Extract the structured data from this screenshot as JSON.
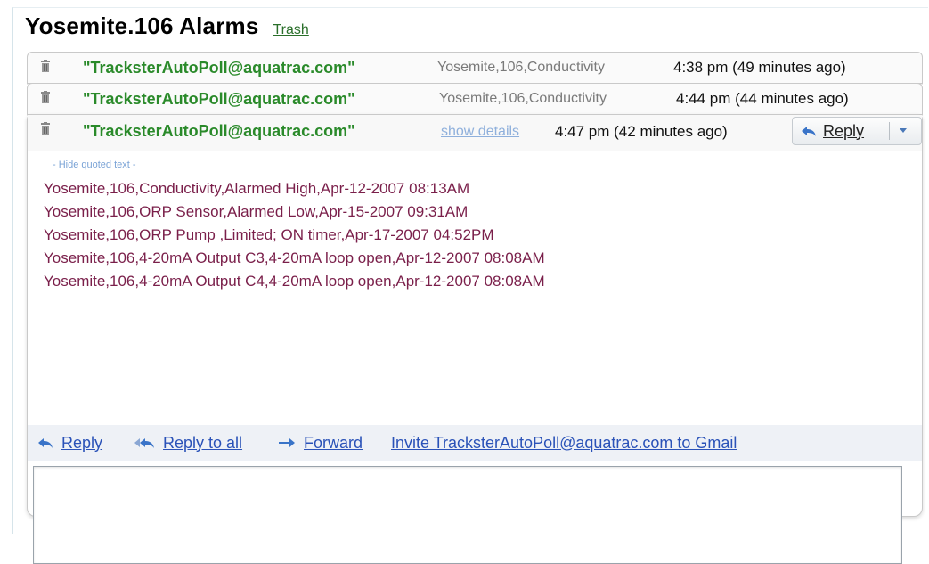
{
  "page": {
    "title": "Yosemite.106 Alarms",
    "trash_link": "Trash"
  },
  "thread": {
    "messages": [
      {
        "sender": "\"TracksterAutoPoll@aquatrac.com\"",
        "subject": "Yosemite,106,Conductivity",
        "time": "4:38 pm (49 minutes ago)"
      },
      {
        "sender": "\"TracksterAutoPoll@aquatrac.com\"",
        "subject": "Yosemite,106,Conductivity",
        "time": "4:44 pm (44 minutes ago)"
      }
    ],
    "expanded": {
      "sender": "\"TracksterAutoPoll@aquatrac.com\"",
      "show_details": "show details",
      "time": "4:47 pm (42 minutes ago)",
      "reply_label": "Reply",
      "hide_quoted": "- Hide quoted text -",
      "body_lines": [
        "Yosemite,106,Conductivity,Alarmed High,Apr-12-2007 08:13AM",
        "Yosemite,106,ORP Sensor,Alarmed Low,Apr-15-2007 09:31AM",
        "Yosemite,106,ORP Pump ,Limited; ON timer,Apr-17-2007 04:52PM",
        "Yosemite,106,4-20mA Output C3,4-20mA loop open,Apr-12-2007 08:08AM",
        "Yosemite,106,4-20mA Output C4,4-20mA loop open,Apr-12-2007 08:08AM"
      ],
      "actions": {
        "reply": "Reply",
        "reply_all": "Reply to all",
        "forward": "Forward",
        "invite": "Invite TracksterAutoPoll@aquatrac.com to Gmail"
      }
    }
  },
  "colors": {
    "sender": "#2a8a2a",
    "link": "#2a52b8",
    "quoted_text": "#7a1f4a"
  }
}
